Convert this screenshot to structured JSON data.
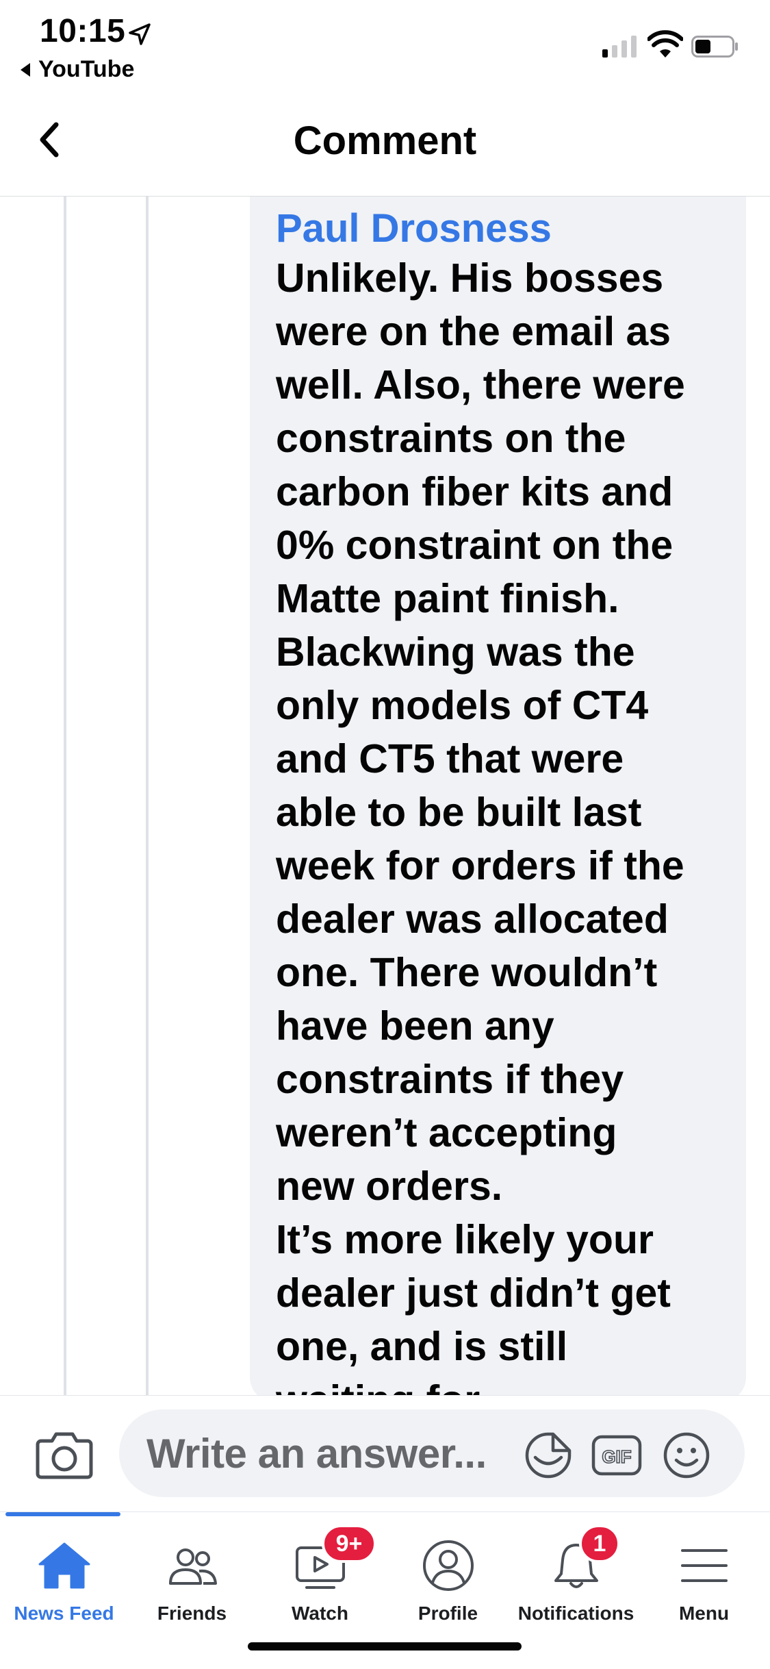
{
  "status_bar": {
    "time": "10:15",
    "back_app": "YouTube"
  },
  "header": {
    "title": "Comment"
  },
  "comment": {
    "author": "Paul Drosness",
    "text": "Unlikely. His bosses\nwere on the email as\nwell. Also, there were\nconstraints on the\ncarbon fiber kits and\n0% constraint on the\nMatte paint finish.\nBlackwing was the\nonly models of CT4\nand CT5 that were\nable to be built last\nweek for orders if the\ndealer was allocated\none. There wouldn’t\nhave been any\nconstraints if they\nweren’t accepting\nnew orders.\nIt’s more likely your\ndealer just didn’t get\none, and is still\nwaiting for"
  },
  "composer": {
    "placeholder": "Write an answer...",
    "icons": [
      "camera-icon",
      "sticker-icon",
      "gif-icon",
      "emoji-icon"
    ]
  },
  "tabs": [
    {
      "label": "News Feed",
      "icon": "home-icon",
      "active": true
    },
    {
      "label": "Friends",
      "icon": "friends-icon"
    },
    {
      "label": "Watch",
      "icon": "watch-icon",
      "badge": "9+"
    },
    {
      "label": "Profile",
      "icon": "profile-icon"
    },
    {
      "label": "Notifications",
      "icon": "bell-icon",
      "badge": "1"
    },
    {
      "label": "Menu",
      "icon": "menu-icon"
    }
  ],
  "colors": {
    "accent": "#3578e5",
    "badge": "#e41e3f",
    "bubble": "#f0f2f5",
    "text": "#050505"
  }
}
